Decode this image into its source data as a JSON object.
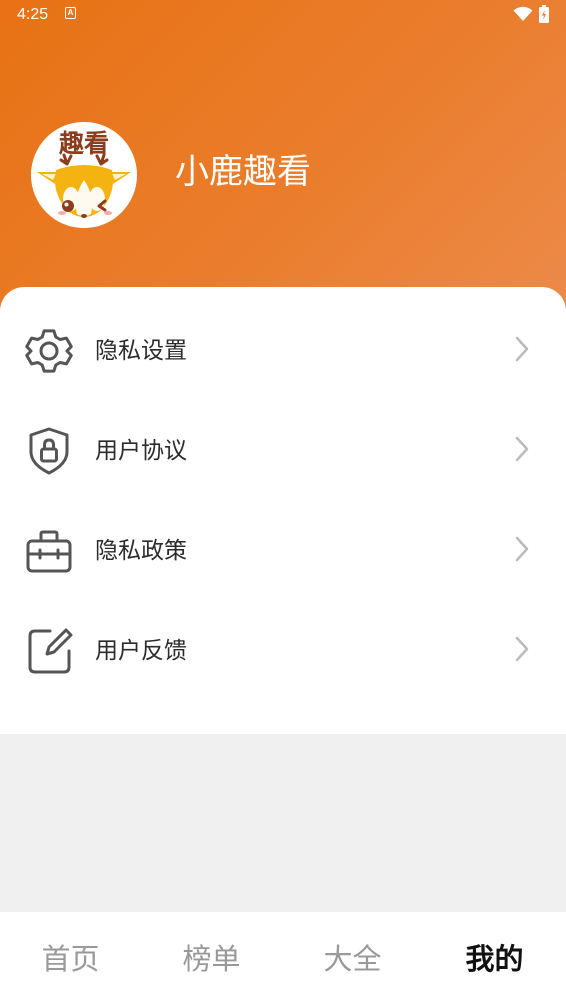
{
  "status_bar": {
    "time": "4:25",
    "notification_badge": "A",
    "icons": [
      "wifi-icon",
      "battery-icon"
    ]
  },
  "profile": {
    "avatar_icon": "deer-logo-icon",
    "avatar_logo_text": "趣看",
    "name": "小鹿趣看"
  },
  "menu": {
    "items": [
      {
        "label": "隐私设置",
        "icon": "gear-icon"
      },
      {
        "label": "用户协议",
        "icon": "shield-lock-icon"
      },
      {
        "label": "隐私政策",
        "icon": "briefcase-icon"
      },
      {
        "label": "用户反馈",
        "icon": "edit-icon"
      }
    ]
  },
  "tabs": [
    {
      "label": "首页",
      "active": false
    },
    {
      "label": "榜单",
      "active": false
    },
    {
      "label": "大全",
      "active": false
    },
    {
      "label": "我的",
      "active": true
    }
  ],
  "colors": {
    "header_gradient_start": "#e87214",
    "header_gradient_end": "#ec8a4a",
    "page_background": "#f0f0f0",
    "icon_gray": "#555555",
    "chevron_gray": "#bbbbbb",
    "tab_inactive": "#999999",
    "tab_active": "#111111",
    "logo_brown": "#8b3d1c",
    "deer_yellow": "#f5b312"
  }
}
